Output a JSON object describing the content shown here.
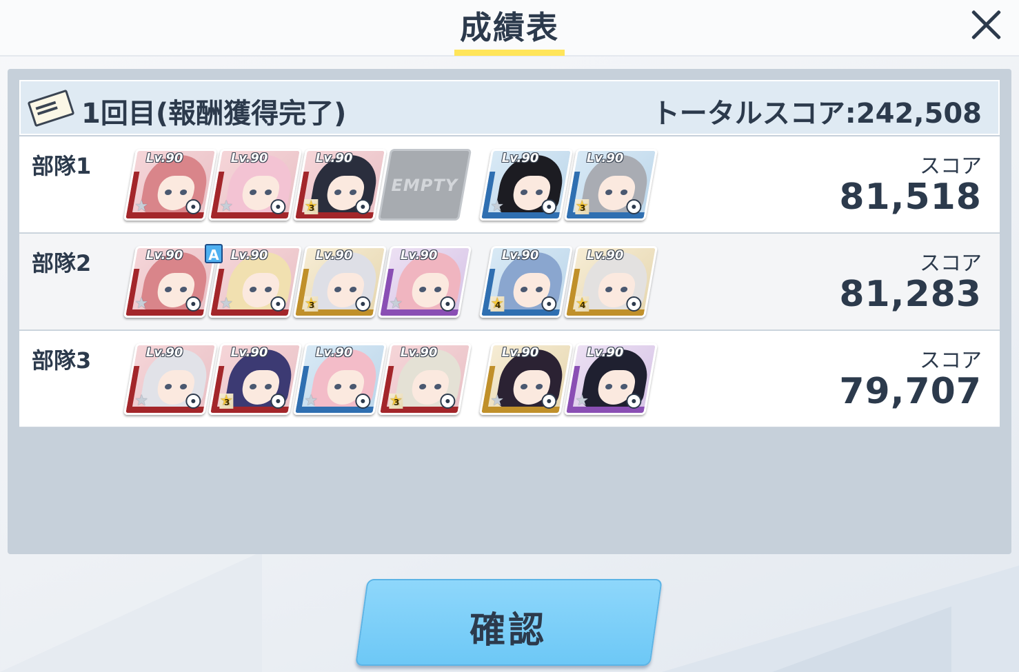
{
  "header": {
    "title": "成績表"
  },
  "round": {
    "label": "1回目(報酬獲得完了)",
    "total_score": "トータルスコア:242,508"
  },
  "squads": [
    {
      "name": "部隊1",
      "score_label": "スコア",
      "score": "81,518",
      "cards": [
        {
          "lv": "Lv.90",
          "color": "red",
          "hair": "#d9858a",
          "star": "",
          "role": "crosshair-icon"
        },
        {
          "lv": "Lv.90",
          "color": "red",
          "hair": "#f3c3d3",
          "star": "",
          "role": "support-icon"
        },
        {
          "lv": "Lv.90",
          "color": "red",
          "hair": "#2a2e3d",
          "star": "3",
          "role": "crosshair-icon"
        },
        {
          "empty": true,
          "label": "EMPTY"
        },
        {
          "lv": "Lv.90",
          "color": "blue",
          "hair": "#1c1c22",
          "star": "",
          "role": "support-icon"
        },
        {
          "lv": "Lv.90",
          "color": "blue",
          "hair": "#a9acb3",
          "star": "3",
          "role": "crosshair-icon"
        }
      ]
    },
    {
      "name": "部隊2",
      "score_label": "スコア",
      "score": "81,283",
      "cards": [
        {
          "lv": "Lv.90",
          "color": "red",
          "hair": "#d9858a",
          "star": "",
          "role": "crosshair-icon"
        },
        {
          "lv": "Lv.90",
          "color": "red",
          "hair": "#f1e0b0",
          "star": "",
          "role": "support-icon"
        },
        {
          "lv": "Lv.90",
          "color": "gold",
          "hair": "#dedfe6",
          "star": "3",
          "role": "crosshair-icon"
        },
        {
          "lv": "Lv.90",
          "color": "purple",
          "hair": "#f0b5c0",
          "star": "",
          "role": "crosshair-icon"
        },
        {
          "lv": "Lv.90",
          "color": "blue",
          "hair": "#8aa6cf",
          "star": "4",
          "role": "support-icon"
        },
        {
          "lv": "Lv.90",
          "color": "gold",
          "hair": "#e3e1e0",
          "star": "4",
          "role": "support-icon"
        }
      ],
      "badge": "A"
    },
    {
      "name": "部隊3",
      "score_label": "スコア",
      "score": "79,707",
      "cards": [
        {
          "lv": "Lv.90",
          "color": "red",
          "hair": "#e1e2e8",
          "star": "",
          "role": "crosshair-icon"
        },
        {
          "lv": "Lv.90",
          "color": "red",
          "hair": "#3c3a73",
          "star": "3",
          "role": "shield-icon"
        },
        {
          "lv": "Lv.90",
          "color": "blue",
          "hair": "#f3bcc8",
          "star": "",
          "role": "support-icon"
        },
        {
          "lv": "Lv.90",
          "color": "red",
          "hair": "#e4e1d5",
          "star": "3",
          "role": "support-icon"
        },
        {
          "lv": "Lv.90",
          "color": "gold",
          "hair": "#2b2233",
          "star": "",
          "role": "support-icon"
        },
        {
          "lv": "Lv.90",
          "color": "purple",
          "hair": "#1f2030",
          "star": "",
          "role": "support-icon"
        }
      ]
    }
  ],
  "confirm_button": {
    "label": "確認"
  },
  "colors": {
    "title_underline": "#ffe55a",
    "confirm": "#7acff8",
    "panel": "#c6d0da"
  }
}
